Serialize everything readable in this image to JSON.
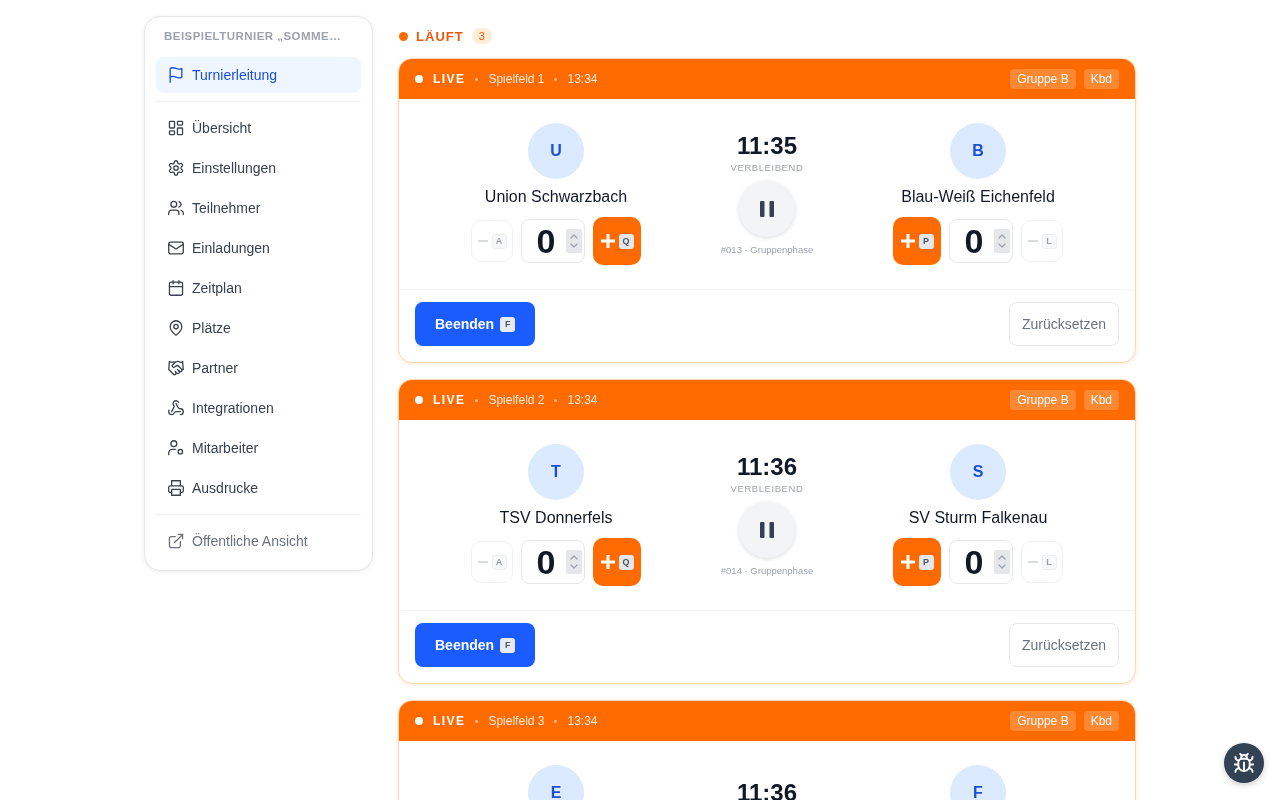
{
  "sidebar": {
    "title": "BEISPIELTURNIER „SOMME…",
    "groups": [
      {
        "items": [
          {
            "label": "Turnierleitung",
            "kind": "page",
            "selected": true
          }
        ]
      },
      {
        "items": [
          {
            "label": "Übersicht",
            "kind": "page",
            "selected": false
          },
          {
            "label": "Einstellungen",
            "kind": "page",
            "selected": false
          },
          {
            "label": "Teilnehmer",
            "kind": "page",
            "selected": false
          },
          {
            "label": "Einladungen",
            "kind": "page",
            "selected": false
          },
          {
            "label": "Zeitplan",
            "kind": "page",
            "selected": false
          },
          {
            "label": "Plätze",
            "kind": "page",
            "selected": false
          },
          {
            "label": "Partner",
            "kind": "page",
            "selected": false
          },
          {
            "label": "Integrationen",
            "kind": "page",
            "selected": false
          },
          {
            "label": "Mitarbeiter",
            "kind": "page",
            "selected": false
          },
          {
            "label": "Ausdrucke",
            "kind": "page",
            "selected": false
          }
        ]
      },
      {
        "items": [
          {
            "label": "Öffentliche Ansicht",
            "kind": "external",
            "selected": false
          }
        ]
      }
    ]
  },
  "section": {
    "label": "LÄUFT",
    "count": "3"
  },
  "matches": [
    {
      "status": "LIVE",
      "field": "Spielfeld 1",
      "time": "13:34",
      "group_tag": "Gruppe B",
      "keyboard_tag": "Kbd",
      "home": {
        "initial": "U",
        "name": "Union Schwarzbach",
        "score": "0",
        "decrement": {
          "key": "A",
          "disabled": true
        },
        "increment": {
          "key": "Q",
          "disabled": false
        }
      },
      "clock": "11:35",
      "clock_label": "VERBLEIBEND",
      "meta": "#013 · Gruppenphase",
      "away": {
        "initial": "B",
        "name": "Blau-Weiß Eichenfeld",
        "score": "0",
        "decrement": {
          "key": "L",
          "disabled": true
        },
        "increment": {
          "key": "P",
          "disabled": false
        }
      },
      "finish": {
        "label": "Beenden",
        "key": "F"
      },
      "reset": {
        "label": "Zurücksetzen"
      }
    },
    {
      "status": "LIVE",
      "field": "Spielfeld 2",
      "time": "13:34",
      "group_tag": "Gruppe B",
      "keyboard_tag": "Kbd",
      "home": {
        "initial": "T",
        "name": "TSV Donnerfels",
        "score": "0",
        "decrement": {
          "key": "A",
          "disabled": true
        },
        "increment": {
          "key": "Q",
          "disabled": false
        }
      },
      "clock": "11:36",
      "clock_label": "VERBLEIBEND",
      "meta": "#014 · Gruppenphase",
      "away": {
        "initial": "S",
        "name": "SV Sturm Falkenau",
        "score": "0",
        "decrement": {
          "key": "L",
          "disabled": true
        },
        "increment": {
          "key": "P",
          "disabled": false
        }
      },
      "finish": {
        "label": "Beenden",
        "key": "F"
      },
      "reset": {
        "label": "Zurücksetzen"
      }
    },
    {
      "status": "LIVE",
      "field": "Spielfeld 3",
      "time": "13:34",
      "group_tag": "Gruppe B",
      "keyboard_tag": "Kbd",
      "home": {
        "initial": "E"
      },
      "clock": "11:36",
      "away": {
        "initial": "F"
      }
    }
  ]
}
